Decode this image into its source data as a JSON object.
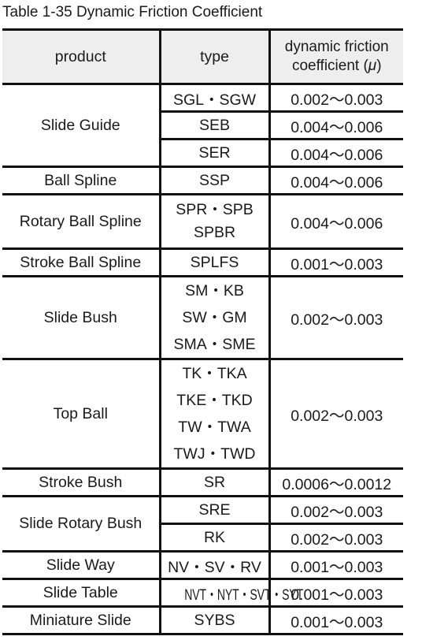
{
  "caption": "Table 1-35 Dynamic Friction Coefficient",
  "headers": {
    "product": "product",
    "type": "type",
    "coefficient_line1": "dynamic friction",
    "coefficient_line2": "coefficient (",
    "coefficient_symbol": "μ",
    "coefficient_close": ")"
  },
  "rows": [
    {
      "product": "Slide Guide",
      "entries": [
        {
          "types": [
            "SGL・SGW"
          ],
          "coefficient": "0.002～0.003"
        },
        {
          "types": [
            "SEB"
          ],
          "coefficient": "0.004～0.006"
        },
        {
          "types": [
            "SER"
          ],
          "coefficient": "0.004～0.006"
        }
      ]
    },
    {
      "product": "Ball Spline",
      "entries": [
        {
          "types": [
            "SSP"
          ],
          "coefficient": "0.004～0.006"
        }
      ]
    },
    {
      "product": "Rotary Ball Spline",
      "entries": [
        {
          "types": [
            "SPR・SPB",
            "SPBR"
          ],
          "coefficient": "0.004～0.006"
        }
      ]
    },
    {
      "product": "Stroke Ball Spline",
      "entries": [
        {
          "types": [
            "SPLFS"
          ],
          "coefficient": "0.001～0.003"
        }
      ]
    },
    {
      "product": "Slide Bush",
      "entries": [
        {
          "types": [
            "SM・KB",
            "SW・GM",
            "SMA・SME"
          ],
          "coefficient": "0.002～0.003"
        }
      ]
    },
    {
      "product": "Top Ball",
      "entries": [
        {
          "types": [
            "TK・TKA",
            "TKE・TKD",
            "TW・TWA",
            "TWJ・TWD"
          ],
          "coefficient": "0.002～0.003"
        }
      ]
    },
    {
      "product": "Stroke Bush",
      "entries": [
        {
          "types": [
            "SR"
          ],
          "coefficient": "0.0006～0.0012"
        }
      ]
    },
    {
      "product": "Slide Rotary Bush",
      "entries": [
        {
          "types": [
            "SRE"
          ],
          "coefficient": "0.002～0.003"
        },
        {
          "types": [
            "RK"
          ],
          "coefficient": "0.002～0.003"
        }
      ]
    },
    {
      "product": "Slide Way",
      "entries": [
        {
          "types": [
            "NV・SV・RV"
          ],
          "coefficient": "0.001～0.003"
        }
      ]
    },
    {
      "product": "Slide Table",
      "entries": [
        {
          "types": [
            "NVT・NYT・SVT・SYT"
          ],
          "coefficient": "0.001～0.003"
        }
      ]
    },
    {
      "product": "Miniature Slide",
      "entries": [
        {
          "types": [
            "SYBS"
          ],
          "coefficient": "0.001～0.003"
        }
      ]
    }
  ]
}
